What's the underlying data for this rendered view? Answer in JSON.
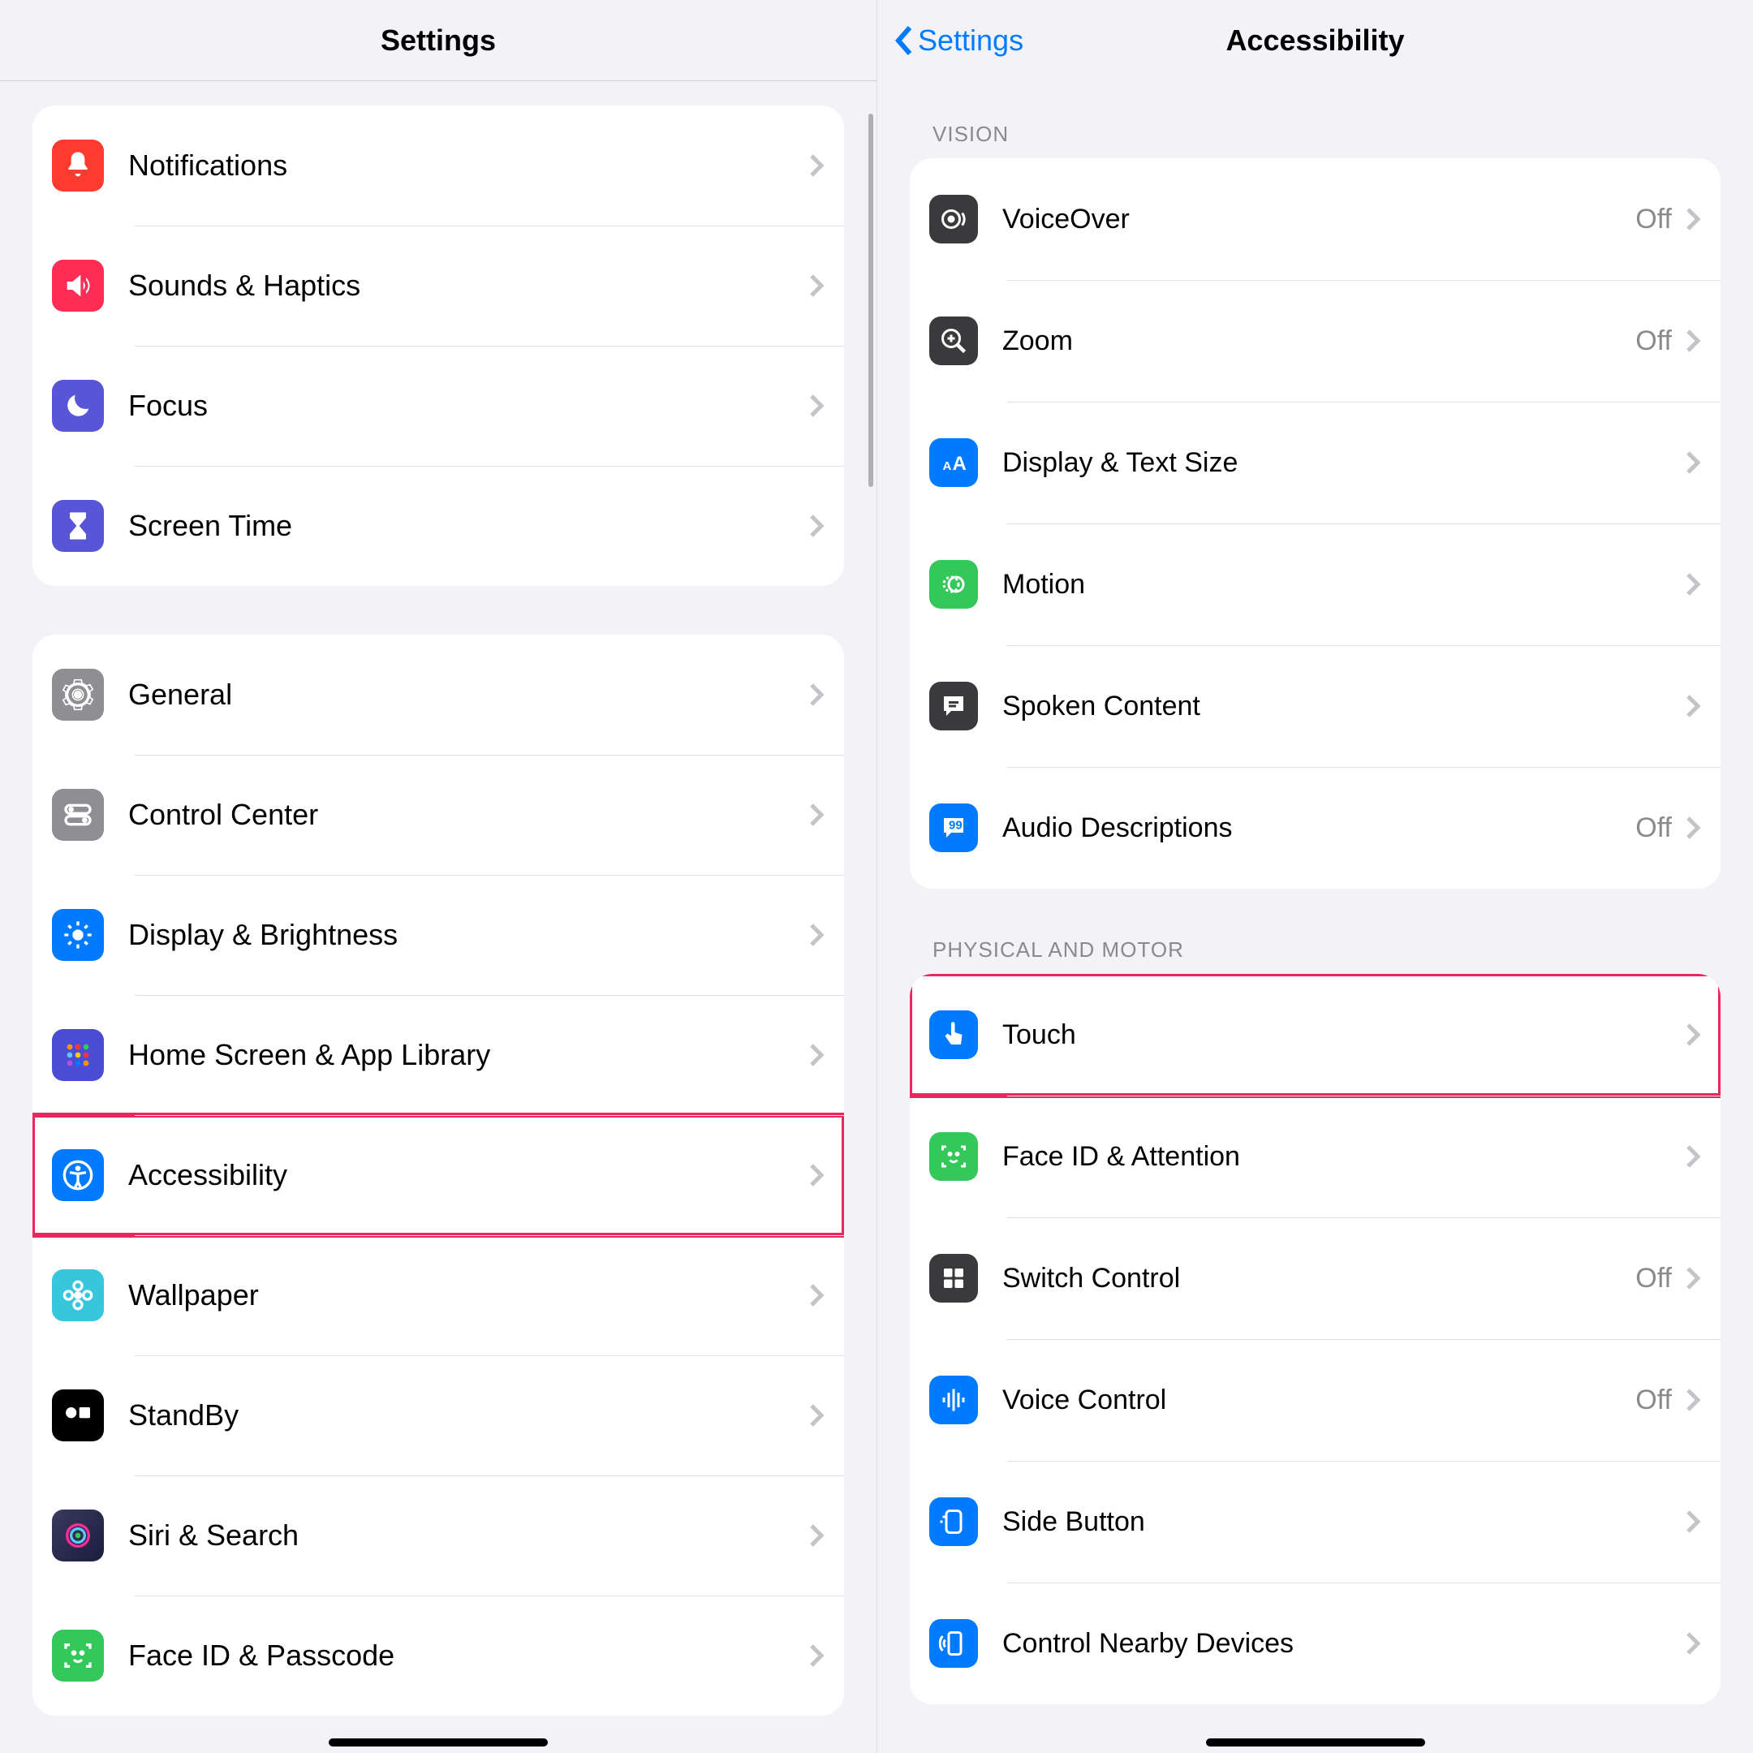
{
  "left": {
    "title": "Settings",
    "group1": [
      {
        "id": "notifications",
        "label": "Notifications",
        "bg": "#ff3b30"
      },
      {
        "id": "sounds",
        "label": "Sounds & Haptics",
        "bg": "#ff2d55"
      },
      {
        "id": "focus",
        "label": "Focus",
        "bg": "#5856d6"
      },
      {
        "id": "screentime",
        "label": "Screen Time",
        "bg": "#5856d6"
      }
    ],
    "group2": [
      {
        "id": "general",
        "label": "General",
        "bg": "#8e8e93"
      },
      {
        "id": "controlcenter",
        "label": "Control Center",
        "bg": "#8e8e93"
      },
      {
        "id": "display",
        "label": "Display & Brightness",
        "bg": "#007aff"
      },
      {
        "id": "homescreen",
        "label": "Home Screen & App Library",
        "bg": "#4a4cd6"
      },
      {
        "id": "accessibility",
        "label": "Accessibility",
        "bg": "#007aff",
        "highlight": true
      },
      {
        "id": "wallpaper",
        "label": "Wallpaper",
        "bg": "#36c7dc"
      },
      {
        "id": "standby",
        "label": "StandBy",
        "bg": "#000000"
      },
      {
        "id": "siri",
        "label": "Siri & Search",
        "bg": "#1c1c1e"
      },
      {
        "id": "faceidpass",
        "label": "Face ID & Passcode",
        "bg": "#34c759"
      }
    ]
  },
  "right": {
    "back": "Settings",
    "title": "Accessibility",
    "sections": [
      {
        "header": "VISION",
        "items": [
          {
            "id": "voiceover",
            "label": "VoiceOver",
            "value": "Off",
            "bg": "#3a3a3c"
          },
          {
            "id": "zoom",
            "label": "Zoom",
            "value": "Off",
            "bg": "#3a3a3c"
          },
          {
            "id": "displaytext",
            "label": "Display & Text Size",
            "bg": "#007aff"
          },
          {
            "id": "motion",
            "label": "Motion",
            "bg": "#34c759"
          },
          {
            "id": "spoken",
            "label": "Spoken Content",
            "bg": "#3a3a3c"
          },
          {
            "id": "audiodesc",
            "label": "Audio Descriptions",
            "value": "Off",
            "bg": "#007aff"
          }
        ]
      },
      {
        "header": "PHYSICAL AND MOTOR",
        "items": [
          {
            "id": "touch",
            "label": "Touch",
            "bg": "#007aff",
            "highlight": true
          },
          {
            "id": "faceidatt",
            "label": "Face ID & Attention",
            "bg": "#34c759"
          },
          {
            "id": "switchcontrol",
            "label": "Switch Control",
            "value": "Off",
            "bg": "#3a3a3c"
          },
          {
            "id": "voicecontrol",
            "label": "Voice Control",
            "value": "Off",
            "bg": "#007aff"
          },
          {
            "id": "sidebutton",
            "label": "Side Button",
            "bg": "#007aff"
          },
          {
            "id": "nearby",
            "label": "Control Nearby Devices",
            "bg": "#007aff"
          }
        ]
      }
    ]
  }
}
